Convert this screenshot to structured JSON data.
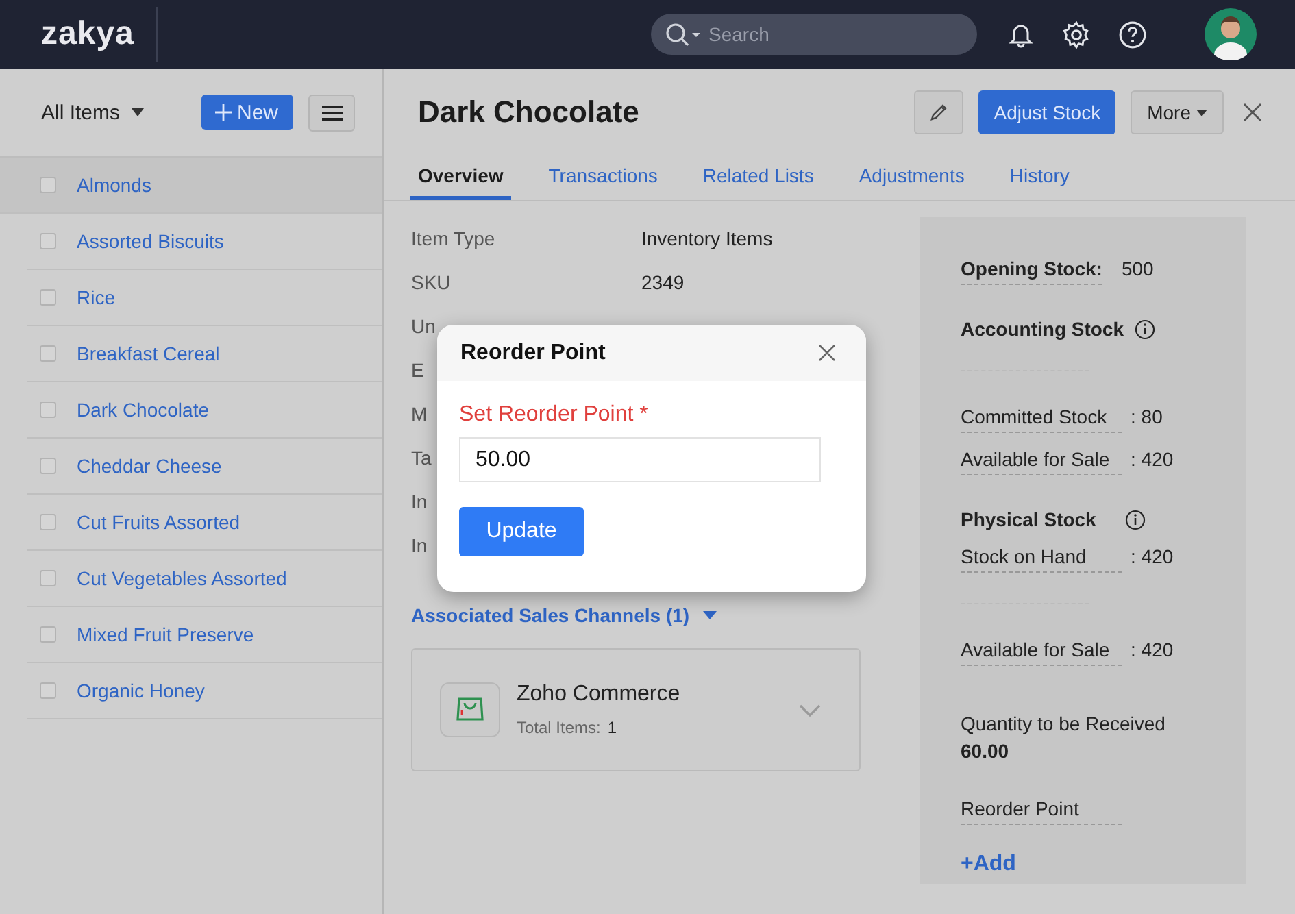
{
  "topbar": {
    "logo": "zakya",
    "search": {
      "placeholder": "Search"
    }
  },
  "sidebar": {
    "view": "All Items",
    "new_button": "New",
    "items": [
      {
        "name": "Almonds",
        "selected": true,
        "checked": false
      },
      {
        "name": "Assorted Biscuits",
        "selected": false,
        "checked": false
      },
      {
        "name": "Rice",
        "selected": false,
        "checked": false
      },
      {
        "name": "Breakfast Cereal",
        "selected": false,
        "checked": false
      },
      {
        "name": "Dark Chocolate",
        "selected": false,
        "checked": false
      },
      {
        "name": "Cheddar Cheese",
        "selected": false,
        "checked": false
      },
      {
        "name": "Cut Fruits Assorted",
        "selected": false,
        "checked": false
      },
      {
        "name": "Cut Vegetables Assorted",
        "selected": false,
        "checked": false
      },
      {
        "name": "Mixed Fruit Preserve",
        "selected": false,
        "checked": false
      },
      {
        "name": "Organic Honey",
        "selected": false,
        "checked": false
      }
    ]
  },
  "detail": {
    "title": "Dark Chocolate",
    "adjust_button": "Adjust Stock",
    "more_button": "More",
    "tabs": [
      {
        "label": "Overview",
        "selected": true
      },
      {
        "label": "Transactions",
        "selected": false
      },
      {
        "label": "Related Lists",
        "selected": false
      },
      {
        "label": "Adjustments",
        "selected": false
      },
      {
        "label": "History",
        "selected": false
      }
    ],
    "fields": [
      {
        "label": "Item Type",
        "value": "Inventory Items"
      },
      {
        "label": "SKU",
        "value": "2349"
      },
      {
        "label": "Un"
      },
      {
        "label": "E"
      },
      {
        "label": "M"
      },
      {
        "label": "Ta"
      },
      {
        "label": "In"
      },
      {
        "label": "In"
      }
    ],
    "sales_channels": {
      "title": "Associated Sales Channels (1)",
      "channels": [
        {
          "name": "Zoho Commerce",
          "count_label": "Total Items:",
          "count": "1"
        }
      ]
    }
  },
  "stock": [
    {
      "kind": "opening",
      "label": "Opening Stock:",
      "value": "500"
    },
    {
      "kind": "heading",
      "label": "Accounting Stock"
    },
    {
      "kind": "blank"
    },
    {
      "kind": "row",
      "label": "Committed Stock",
      "value": ": 80"
    },
    {
      "kind": "row",
      "label": "Available for Sale",
      "value": ": 420"
    },
    {
      "kind": "heading",
      "label": "Physical Stock"
    },
    {
      "kind": "row",
      "label": "Stock on Hand",
      "value": ": 420"
    },
    {
      "kind": "blank"
    },
    {
      "kind": "row",
      "label": "Available for Sale",
      "value": ": 420"
    },
    {
      "kind": "quantity",
      "label": "Quantity to be Received",
      "value": "60.00"
    },
    {
      "kind": "reorder",
      "label": "Reorder Point"
    },
    {
      "kind": "link",
      "label": "+Add"
    }
  ],
  "dialog": {
    "title": "Reorder Point",
    "field_label": "Set Reorder Point",
    "required_mark": "*",
    "value": "50.00",
    "button": "Update"
  }
}
